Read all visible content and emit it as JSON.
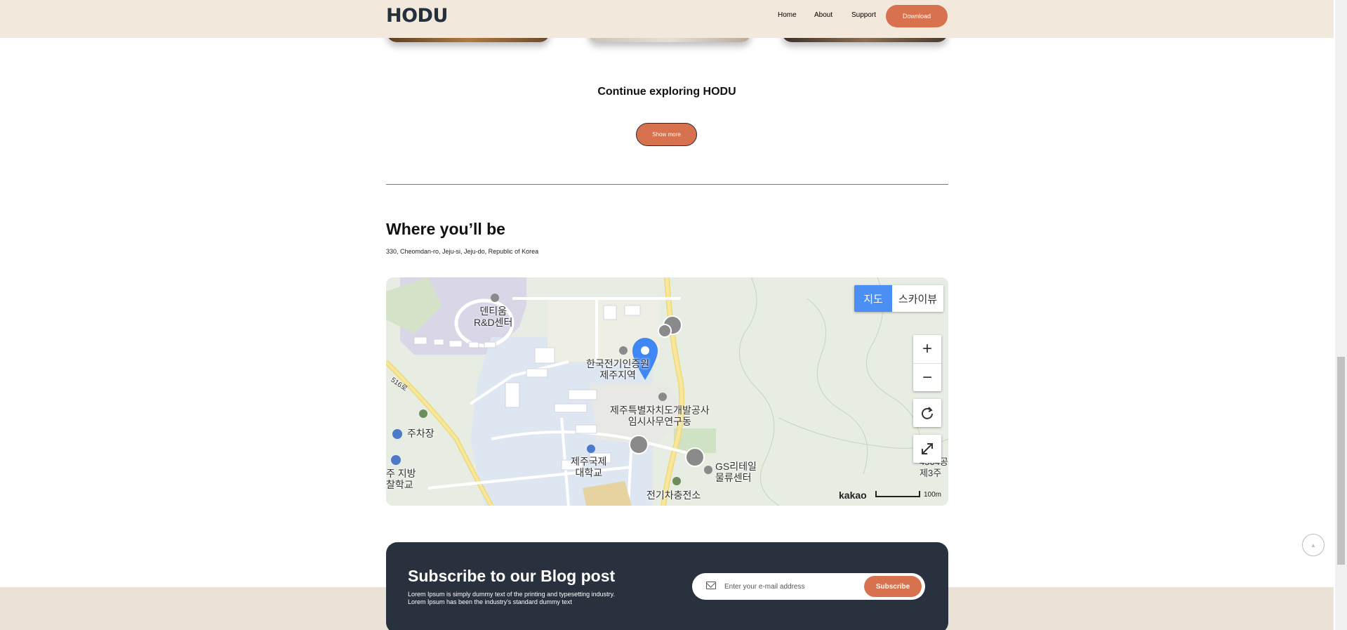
{
  "header": {
    "logo": "HODU",
    "nav": [
      {
        "label": "Home"
      },
      {
        "label": "About"
      },
      {
        "label": "Support"
      }
    ],
    "download_label": "Download"
  },
  "explore": {
    "title": "Continue exploring HODU",
    "show_more_label": "Show more"
  },
  "location": {
    "title": "Where you’ll be",
    "address": "330, Cheomdan-ro, Jeju-si, Jeju-do, Republic of Korea"
  },
  "map": {
    "type_map": "지도",
    "type_skyview": "스카이뷰",
    "zoom_in": "+",
    "zoom_out": "−",
    "provider": "kakao",
    "scale": "100m",
    "labels": {
      "dentiom": "덴티움\nR&D센터",
      "kepco": "한국전기인증원\n제주지역",
      "jdc": "제주특별자치도개발공사\n임시사무연구동",
      "parking": "주차장",
      "university": "제주국제\n대학교",
      "police_school": "주 지방\n찰학교",
      "gs_retail": "GS리테일\n물류센터",
      "ev_charge": "전기차충전소",
      "road_516": "516로",
      "right_edge": "4504공\n제3주"
    }
  },
  "subscribe": {
    "title": "Subscribe to our Blog post",
    "desc_line1": "Lorem Ipsum is simply dummy text of the printing and typesetting industry.",
    "desc_line2": "Lorem Ipsum has been the industry's standard dummy text",
    "email_placeholder": "Enter your e-mail address",
    "button_label": "Subscribe"
  },
  "colors": {
    "header_bg": "#f2e8dc",
    "accent": "#d8714d",
    "dark_panel": "#28313d",
    "map_marker": "#3f87f5"
  }
}
